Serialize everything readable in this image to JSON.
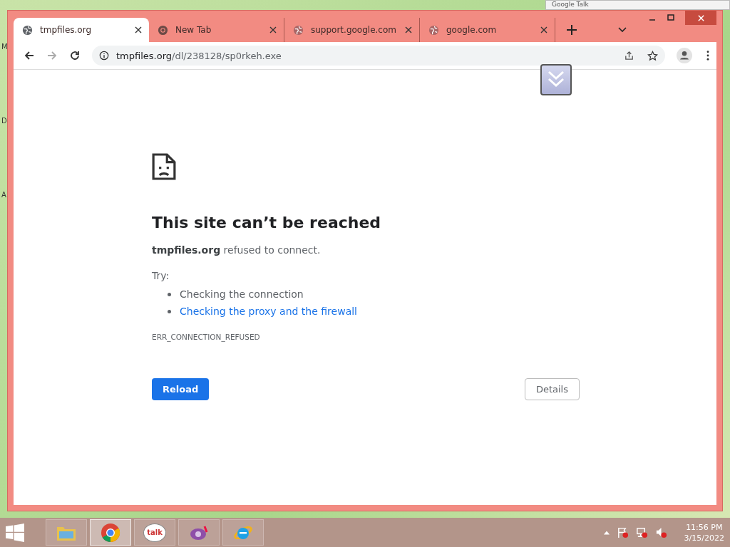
{
  "desktop": {
    "edge_labels": [
      "M",
      "D",
      "A"
    ],
    "background_window": {
      "title": "Google Talk"
    }
  },
  "browser": {
    "tabs": [
      {
        "title": "tmpfiles.org",
        "selected": true,
        "kind": "globe"
      },
      {
        "title": "New Tab",
        "selected": false,
        "kind": "chrome"
      },
      {
        "title": "support.google.com",
        "selected": false,
        "kind": "globe"
      },
      {
        "title": "google.com",
        "selected": false,
        "kind": "globe"
      }
    ],
    "address": {
      "host": "tmpfiles.org",
      "path": "/dl/238128/sp0rkeh.exe"
    }
  },
  "error_page": {
    "title": "This site can’t be reached",
    "message": "**tmpfiles.org** refused to connect.",
    "try_label": "Try:",
    "suggestions": [
      {
        "text": "Checking the connection",
        "kind": "text"
      },
      {
        "text": "Checking the proxy and the firewall",
        "kind": "link"
      }
    ],
    "error_code": "ERR_CONNECTION_REFUSED",
    "buttons": [
      {
        "label": "Reload",
        "kind": "primary"
      },
      {
        "label": "Details",
        "kind": "secondary"
      }
    ]
  },
  "taskbar": {
    "apps": [
      {
        "kind": "folder",
        "selected": false
      },
      {
        "kind": "chrome",
        "selected": true
      },
      {
        "kind": "talk",
        "label": "talk",
        "selected": false
      },
      {
        "kind": "messenger",
        "selected": false
      },
      {
        "kind": "ie",
        "selected": false
      }
    ],
    "clock": {
      "time": "11:56 PM",
      "date": "3/15/2022"
    }
  }
}
